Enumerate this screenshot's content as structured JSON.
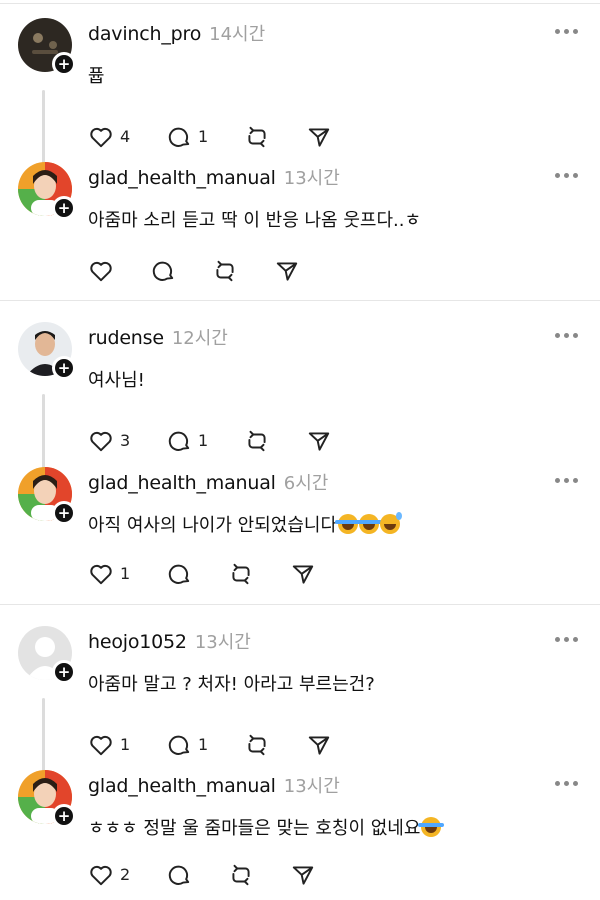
{
  "colors": {
    "text": "#111111",
    "muted": "#a0a0a0",
    "divider": "#e6e6e6",
    "thread_line": "#dcdcdc"
  },
  "icons": {
    "like": "heart-icon",
    "reply": "comment-icon",
    "repost": "repost-icon",
    "share": "send-icon",
    "more": "more-icon",
    "follow": "plus-icon"
  },
  "follow_glyph": "+",
  "posts": [
    {
      "username": "davinch_pro",
      "time": "14시간",
      "text": "퓹",
      "likes": "4",
      "replies": "1",
      "avatar": "dark-photo"
    },
    {
      "username": "glad_health_manual",
      "time": "13시간",
      "text": "아줌마 소리 듣고 딱 이 반응 나옴 웃프다..ㅎ",
      "likes": "",
      "replies": "",
      "avatar": "woman-photo"
    },
    {
      "username": "rudense",
      "time": "12시간",
      "text": "여사님!",
      "likes": "3",
      "replies": "1",
      "avatar": "man-photo"
    },
    {
      "username": "glad_health_manual",
      "time": "6시간",
      "text": "아직 여사의 나이가 안되었습니다",
      "emojis": [
        "face-with-tears-of-joy",
        "face-with-tears-of-joy",
        "grinning-face-with-sweat"
      ],
      "likes": "1",
      "replies": "",
      "avatar": "woman-photo"
    },
    {
      "username": "heojo1052",
      "time": "13시간",
      "text": "아줌마 말고 ? 처자! 아라고 부르는건?",
      "likes": "1",
      "replies": "1",
      "avatar": "default-avatar"
    },
    {
      "username": "glad_health_manual",
      "time": "13시간",
      "text": "ㅎㅎㅎ 정말 울 줌마들은 맞는 호칭이 없네요",
      "emojis": [
        "rolling-on-the-floor-laughing"
      ],
      "likes": "2",
      "replies": "",
      "avatar": "woman-photo"
    }
  ]
}
